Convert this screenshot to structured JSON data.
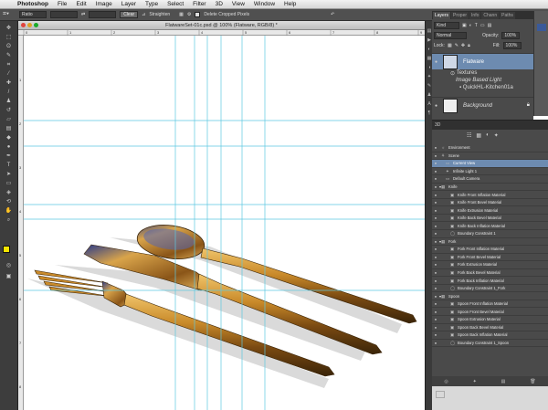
{
  "menubar": {
    "apple": "",
    "app_name": "Photoshop",
    "items": [
      "File",
      "Edit",
      "Image",
      "Layer",
      "Type",
      "Select",
      "Filter",
      "3D",
      "View",
      "Window",
      "Help"
    ]
  },
  "options_bar": {
    "ratio_select": "Ratio",
    "clear_label": "Clear",
    "straighten_label": "Straighten",
    "delete_cropped_label": "Delete Cropped Pixels"
  },
  "document": {
    "title": "FlatwareSet-01c.psd @ 100% (Flatware, RGB/8) *"
  },
  "ruler_h_ticks": [
    "0",
    "1",
    "2",
    "3",
    "4",
    "5",
    "6",
    "7",
    "8",
    "9"
  ],
  "ruler_v_ticks": [
    "1",
    "2",
    "3",
    "4",
    "5",
    "6",
    "7",
    "8"
  ],
  "layers_panel": {
    "tabs": [
      "Layers",
      "Proper",
      "Info",
      "Chann",
      "Paths"
    ],
    "kind_label": "Kind",
    "blend_mode": "Normal",
    "opacity_label": "Opacity:",
    "opacity_value": "100%",
    "lock_label": "Lock:",
    "fill_label": "Fill:",
    "fill_value": "100%",
    "layers": [
      {
        "name": "Flatware"
      },
      {
        "name": "Textures"
      },
      {
        "name": "Image Based Light"
      },
      {
        "name": "QuickHL-Kitchen01a"
      },
      {
        "name": "Background"
      }
    ]
  },
  "panel_3d": {
    "header": "3D",
    "tree": [
      {
        "label": "Environment",
        "level": 0,
        "icon": "env"
      },
      {
        "label": "Scene",
        "level": 0,
        "icon": "scene"
      },
      {
        "label": "Current View",
        "level": 1,
        "icon": "camera",
        "selected": true
      },
      {
        "label": "Infinite Light 1",
        "level": 1,
        "icon": "light"
      },
      {
        "label": "Default Camera",
        "level": 1,
        "icon": "camera"
      },
      {
        "label": "Knife",
        "level": 0,
        "icon": "mesh"
      },
      {
        "label": "Knife Front Inflation Material",
        "level": 2,
        "icon": "material"
      },
      {
        "label": "Knife Front Bevel Material",
        "level": 2,
        "icon": "material"
      },
      {
        "label": "Knife Extrusion Material",
        "level": 2,
        "icon": "material"
      },
      {
        "label": "Knife Back Bevel Material",
        "level": 2,
        "icon": "material"
      },
      {
        "label": "Knife Back Inflation Material",
        "level": 2,
        "icon": "material"
      },
      {
        "label": "Boundary Constraint 1",
        "level": 2,
        "icon": "constraint"
      },
      {
        "label": "Fork",
        "level": 0,
        "icon": "mesh"
      },
      {
        "label": "Fork Front Inflation Material",
        "level": 2,
        "icon": "material"
      },
      {
        "label": "Fork Front Bevel Material",
        "level": 2,
        "icon": "material"
      },
      {
        "label": "Fork Extrusion Material",
        "level": 2,
        "icon": "material"
      },
      {
        "label": "Fork Back Bevel Material",
        "level": 2,
        "icon": "material"
      },
      {
        "label": "Fork Back Inflation Material",
        "level": 2,
        "icon": "material"
      },
      {
        "label": "Boundary Constraint 1_Fork",
        "level": 2,
        "icon": "constraint"
      },
      {
        "label": "Spoon",
        "level": 0,
        "icon": "mesh"
      },
      {
        "label": "Spoon Front Inflation Material",
        "level": 2,
        "icon": "material"
      },
      {
        "label": "Spoon Front Bevel Material",
        "level": 2,
        "icon": "material"
      },
      {
        "label": "Spoon Extrusion Material",
        "level": 2,
        "icon": "material"
      },
      {
        "label": "Spoon Back Bevel Material",
        "level": 2,
        "icon": "material"
      },
      {
        "label": "Spoon Back Inflation Material",
        "level": 2,
        "icon": "material"
      },
      {
        "label": "Boundary Constraint 1_Spoon",
        "level": 2,
        "icon": "constraint"
      }
    ]
  },
  "colors": {
    "guide": "#5ec8e0",
    "foreground": "#f5e400",
    "background": "#ffffff",
    "selection": "#6d8bb0"
  }
}
